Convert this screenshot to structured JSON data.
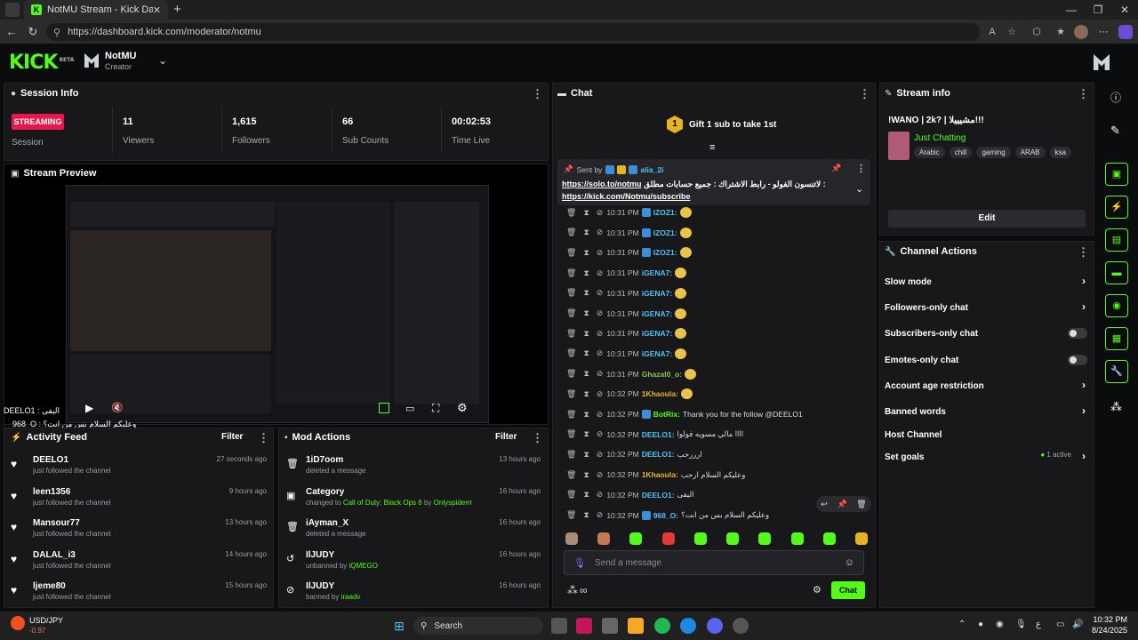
{
  "browser": {
    "tab_title": "NotMU Stream - Kick Dashboard",
    "url": "https://dashboard.kick.com/moderator/notmu"
  },
  "header": {
    "logo": "KICK",
    "logo_badge": "BETA",
    "channel_name": "NotMU",
    "role": "Creator"
  },
  "session": {
    "title": "Session Info",
    "status": "STREAMING",
    "status_label": "Session",
    "stats": [
      {
        "value": "11",
        "label": "Viewers"
      },
      {
        "value": "1,615",
        "label": "Followers"
      },
      {
        "value": "66",
        "label": "Sub Counts"
      },
      {
        "value": "00:02:53",
        "label": "Time Live"
      }
    ]
  },
  "preview": {
    "title": "Stream Preview",
    "overlay1": "DEELO1 : اليفى",
    "overlay2": "968_O : وعليكم السلام بس من انت؟"
  },
  "activity": {
    "title": "Activity Feed",
    "filter": "Filter",
    "items": [
      {
        "user": "DEELO1",
        "action": "just followed the channel",
        "time": "27 seconds ago"
      },
      {
        "user": "leen1356",
        "action": "just followed the channel",
        "time": "9 hours ago"
      },
      {
        "user": "Mansour77",
        "action": "just followed the channel",
        "time": "13 hours ago"
      },
      {
        "user": "DALAL_i3",
        "action": "just followed the channel",
        "time": "14 hours ago"
      },
      {
        "user": "ljeme80",
        "action": "just followed the channel",
        "time": "15 hours ago"
      }
    ]
  },
  "mod": {
    "title": "Mod Actions",
    "filter": "Filter",
    "items": [
      {
        "user": "1iD7oom",
        "action": "deleted a message",
        "extra": "",
        "time": "13 hours ago",
        "icon": "trash-icon"
      },
      {
        "user": "Category",
        "action": "changed to",
        "extra": "Call of Duty: Black Ops 6",
        "by": "by",
        "by_user": "Onlyspiderrr",
        "time": "16 hours ago",
        "icon": "category-icon"
      },
      {
        "user": "iAyman_X",
        "action": "deleted a message",
        "extra": "",
        "time": "16 hours ago",
        "icon": "trash-icon"
      },
      {
        "user": "IlJUDY",
        "action": "unbanned by",
        "extra": "iQMEGO",
        "time": "16 hours ago",
        "icon": "unban-icon"
      },
      {
        "user": "IlJUDY",
        "action": "banned by",
        "extra": "iraadv",
        "time": "16 hours ago",
        "icon": "ban-icon"
      }
    ]
  },
  "chat": {
    "title": "Chat",
    "gift": "Gift 1 sub to take 1st",
    "gift_rank": "1",
    "pinned": {
      "sent_by": "Sent by",
      "user": "alia_2i",
      "text": "لاتنسون الفولو - رابط الاشتراك : جميع حسابات مطلق :",
      "link1": "https://solo.to/notmu",
      "link2": "https://kick.com/Notmu/subscribe"
    },
    "messages": [
      {
        "time": "10:31 PM",
        "user": "IZOZ1:",
        "text": "",
        "color": "#4fc3f7"
      },
      {
        "time": "10:31 PM",
        "user": "IZOZ1:",
        "text": "",
        "color": "#4fc3f7"
      },
      {
        "time": "10:31 PM",
        "user": "IZOZ1:",
        "text": "",
        "color": "#4fc3f7"
      },
      {
        "time": "10:31 PM",
        "user": "iGENA7:",
        "text": "",
        "color": "#4fc3f7"
      },
      {
        "time": "10:31 PM",
        "user": "iGENA7:",
        "text": "",
        "color": "#4fc3f7"
      },
      {
        "time": "10:31 PM",
        "user": "iGENA7:",
        "text": "",
        "color": "#4fc3f7"
      },
      {
        "time": "10:31 PM",
        "user": "iGENA7:",
        "text": "",
        "color": "#4fc3f7"
      },
      {
        "time": "10:31 PM",
        "user": "iGENA7:",
        "text": "",
        "color": "#4fc3f7"
      },
      {
        "time": "10:31 PM",
        "user": "Ghazal0_o:",
        "text": "",
        "color": "#8bc34a"
      },
      {
        "time": "10:32 PM",
        "user": "1Khaoula:",
        "text": "",
        "color": "#e6b422"
      },
      {
        "time": "10:32 PM",
        "user": "BotRix:",
        "text": "Thank you for the follow @DEELO1",
        "color": "#53fc18"
      },
      {
        "time": "10:32 PM",
        "user": "DEELO1:",
        "text": "اااا مالي مسويه فولوا",
        "color": "#4fc3f7"
      },
      {
        "time": "10:32 PM",
        "user": "DEELO1:",
        "text": "ارررحب",
        "color": "#4fc3f7"
      },
      {
        "time": "10:32 PM",
        "user": "1Khaoula:",
        "text": "وعليكم السلام ارحب",
        "color": "#e6b422"
      },
      {
        "time": "10:32 PM",
        "user": "DEELO1:",
        "text": "اليفى",
        "color": "#4fc3f7"
      },
      {
        "time": "10:32 PM",
        "user": "968_O:",
        "text": "وعليكم السلام بس من انت؟",
        "color": "#4fc3f7"
      }
    ],
    "input_placeholder": "Send a message",
    "send": "Chat"
  },
  "stream_info": {
    "title": "Stream info",
    "stream_title": "!WANO | 2k? | مشيييلا!!!",
    "category": "Just Chatting",
    "tags": [
      "Arabic",
      "chill",
      "gaming",
      "ARAB",
      "ksa"
    ],
    "edit": "Edit"
  },
  "channel_actions": {
    "title": "Channel Actions",
    "items": [
      {
        "label": "Slow mode",
        "type": "chevron"
      },
      {
        "label": "Followers-only chat",
        "type": "chevron"
      },
      {
        "label": "Subscribers-only chat",
        "type": "toggle"
      },
      {
        "label": "Emotes-only chat",
        "type": "toggle"
      },
      {
        "label": "Account age restriction",
        "type": "chevron"
      },
      {
        "label": "Banned words",
        "type": "chevron"
      },
      {
        "label": "Host Channel",
        "type": "none"
      },
      {
        "label": "Set goals",
        "type": "chevron",
        "status": "1 active"
      }
    ]
  },
  "taskbar": {
    "ticker": "USD/JPY",
    "ticker_value": "-0.97",
    "search": "Search",
    "time": "10:32 PM",
    "date": "8/24/2025"
  }
}
